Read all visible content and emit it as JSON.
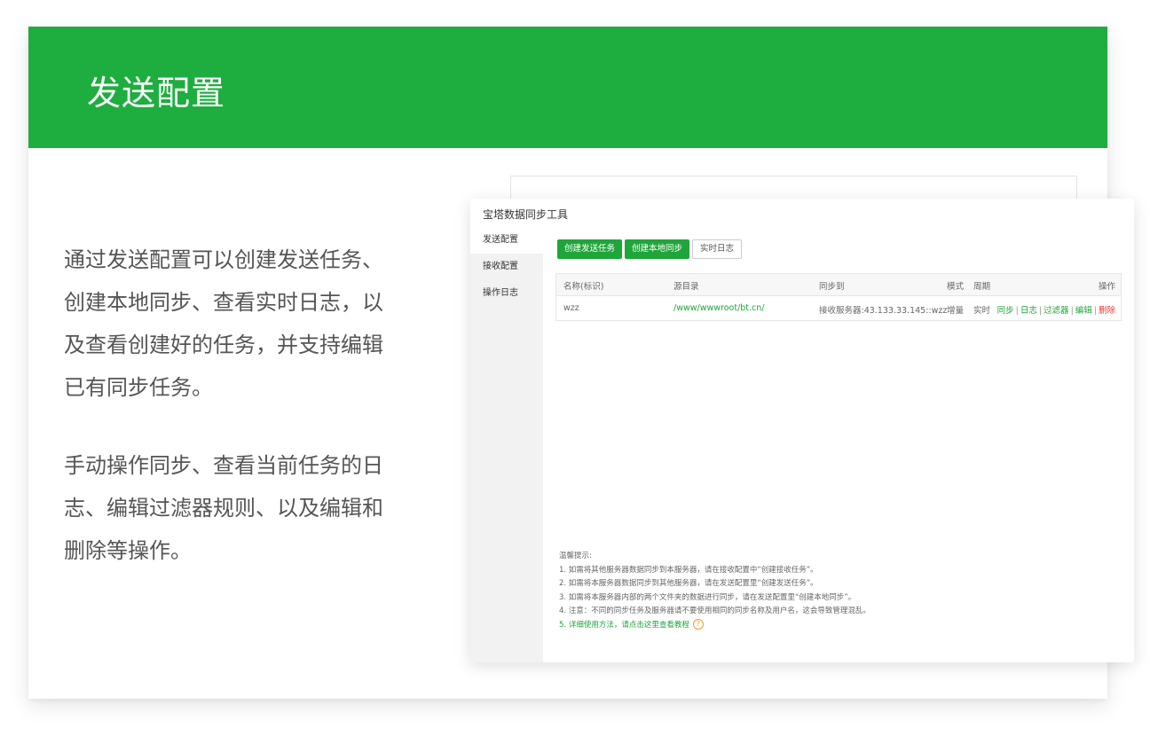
{
  "banner": {
    "title": "发送配置"
  },
  "description": {
    "lines1": [
      "通过发送配置可以创建发送任务、",
      "创建本地同步、查看实时日志，以",
      "及查看创建好的任务，并支持编辑",
      "已有同步任务。"
    ],
    "lines2": [
      "手动操作同步、查看当前任务的日",
      "志、编辑过滤器规则、以及编辑和",
      "删除等操作。"
    ]
  },
  "app": {
    "title": "宝塔数据同步工具",
    "sidebar": [
      "发送配置",
      "接收配置",
      "操作日志"
    ],
    "toolbar": {
      "create_send": "创建发送任务",
      "create_local": "创建本地同步",
      "realtime_log": "实时日志"
    },
    "table": {
      "headers": {
        "name": "名称(标识)",
        "source": "源目录",
        "dest": "同步到",
        "mode": "模式",
        "cycle": "周期",
        "ops": "操作"
      },
      "rows": [
        {
          "name": "wzz",
          "source": "/www/wwwroot/bt.cn/",
          "dest": "接收服务器:43.133.33.145::wzz",
          "mode": "增量",
          "cycle": "实时",
          "ops": [
            "同步",
            "日志",
            "过滤器",
            "编辑",
            "删除"
          ]
        }
      ]
    },
    "tips": {
      "title": "温馨提示:",
      "lines": [
        "1. 如需将其他服务器数据同步到本服务器，请在接收配置中“创建接收任务”。",
        "2. 如需将本服务器数据同步到其他服务器，请在发送配置里“创建发送任务”。",
        "3. 如需将本服务器内部的两个文件夹的数据进行同步，请在发送配置里“创建本地同步”。",
        "4. 注意：不同的同步任务及服务器请不要使用相同的同步名称及用户名，这会导致管理混乱。"
      ],
      "link_prefix": "5. ",
      "link": "详细使用方法，请点击这里查看教程",
      "help_glyph": "?"
    }
  },
  "colors": {
    "brand_green": "#1ead3f",
    "button_green": "#20a53a",
    "delete_red": "#e53935"
  }
}
